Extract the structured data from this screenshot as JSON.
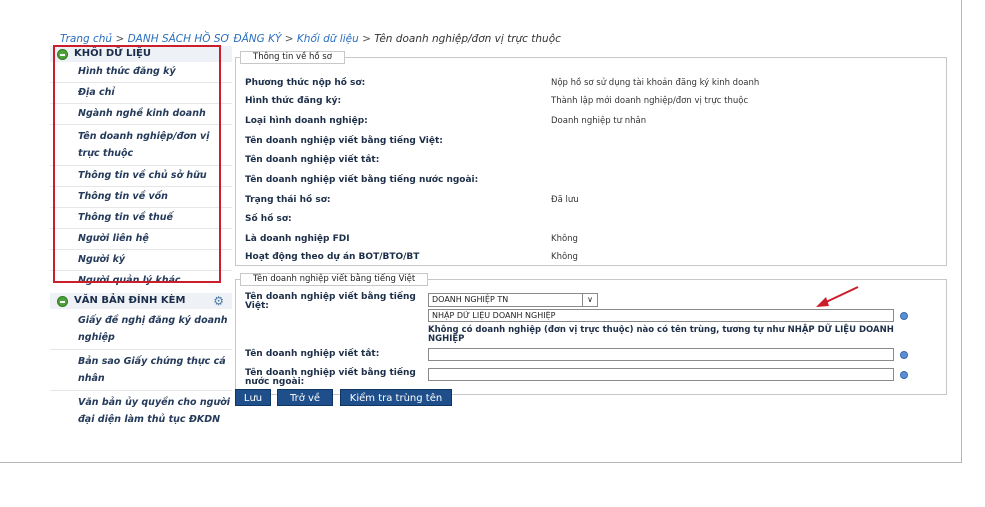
{
  "breadcrumb": {
    "home": "Trang chủ",
    "sep": ">",
    "list": "DANH SÁCH HỒ SƠ ĐĂNG KÝ",
    "block": "Khối dữ liệu",
    "current": "Tên doanh nghiệp/đơn vị trực thuộc"
  },
  "sidebar": {
    "section1": {
      "title": "KHỐI DỮ LIỆU",
      "items": [
        "Hình thức đăng ký",
        "Địa chỉ",
        "Ngành nghề kinh doanh",
        "Tên doanh nghiệp/đơn vị trực thuộc",
        "Thông tin về chủ sở hữu",
        "Thông tin về vốn",
        "Thông tin về thuế",
        "Người liên hệ",
        "Người ký",
        "Người quản lý khác"
      ]
    },
    "section2": {
      "title": "VĂN BẢN ĐÍNH KÈM",
      "items": [
        "Giấy đề nghị đăng ký doanh nghiệp",
        "Bản sao Giấy chứng thực cá nhân",
        "Văn bản ủy quyền cho người đại diện làm thủ tục ĐKDN"
      ]
    }
  },
  "profile_info": {
    "legend": "Thông tin về hồ sơ",
    "rows": [
      {
        "label": "Phương thức nộp hồ sơ:",
        "value": "Nộp hồ sơ sử dụng tài khoản đăng ký kinh doanh"
      },
      {
        "label": "Hình thức đăng ký:",
        "value": "Thành lập mới doanh nghiệp/đơn vị trực thuộc"
      },
      {
        "label": "Loại hình doanh nghiệp:",
        "value": "Doanh nghiệp tư nhân"
      },
      {
        "label": "Tên doanh nghiệp viết bằng tiếng Việt:",
        "value": ""
      },
      {
        "label": "Tên doanh nghiệp viết tắt:",
        "value": ""
      },
      {
        "label": "Tên doanh nghiệp viết bằng tiếng nước ngoài:",
        "value": ""
      },
      {
        "label": "Trạng thái hồ sơ:",
        "value": "Đã lưu"
      },
      {
        "label": "Số hồ sơ:",
        "value": ""
      },
      {
        "label": "Là doanh nghiệp FDI",
        "value": "Không"
      },
      {
        "label": "Hoạt động theo dự án BOT/BTO/BT",
        "value": "Không"
      }
    ]
  },
  "name_form": {
    "legend": "Tên doanh nghiệp viết bằng tiếng Việt",
    "vn_label": "Tên doanh nghiệp viết bằng tiếng Việt:",
    "type_select": "DOANH NGHIỆP TN",
    "select_arrow": "∨",
    "vn_name_value": "NHẬP DỮ LIỆU DOANH NGHIỆP",
    "duplicate_msg": "Không có doanh nghiệp (đơn vị trực thuộc) nào có tên trùng, tương tự như NHẬP DỮ LIỆU DOANH NGHIỆP",
    "abbr_label": "Tên doanh nghiệp viết tắt:",
    "abbr_value": "",
    "foreign_label": "Tên doanh nghiệp viết bằng tiếng nước ngoài:",
    "foreign_value": ""
  },
  "buttons": {
    "save": "Lưu",
    "back": "Trở về",
    "check": "Kiểm tra trùng tên"
  },
  "icons": {
    "section_toggle": "minus-circle-icon",
    "gear": "gear-icon",
    "info": "info-dot-icon",
    "annotation": "red-arrow-icon"
  },
  "colors": {
    "annotation_red": "#cc1d2a",
    "button_blue": "#1e4f8a",
    "link_blue": "#2a6fc0"
  }
}
